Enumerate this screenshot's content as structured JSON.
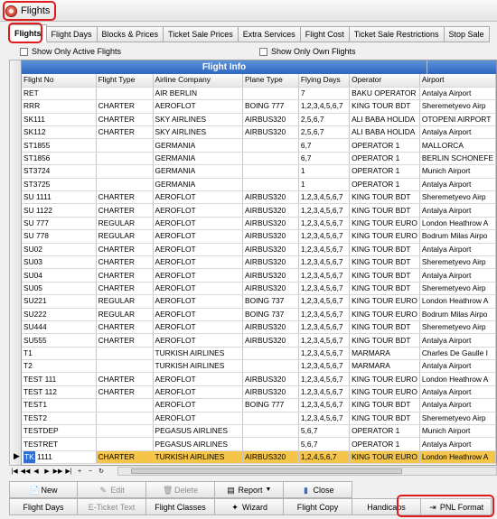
{
  "window": {
    "title": "Flights"
  },
  "tabs": [
    "Flights",
    "Flight Days",
    "Blocks & Prices",
    "Ticket Sale Prices",
    "Extra Services",
    "Flight Cost",
    "Ticket Sale Restrictions",
    "Stop Sale"
  ],
  "filters": {
    "active_label": "Show Only Active Flights",
    "own_label": "Show Only Own Flights"
  },
  "grid": {
    "group_title": "Flight Info",
    "columns": [
      "Flight No",
      "Flight Type",
      "Airline Company",
      "Plane Type",
      "Flying Days",
      "Operator",
      "Airport"
    ],
    "rows": [
      [
        "RET",
        "",
        "AIR BERLIN",
        "",
        "7",
        "BAKU OPERATOR",
        "Antalya Airport"
      ],
      [
        "RRR",
        "CHARTER",
        "AEROFLOT",
        "BOING 777",
        "1,2,3,4,5,6,7",
        "KING TOUR BDT",
        "Sheremetyevo Airp"
      ],
      [
        "SK111",
        "CHARTER",
        "SKY AIRLINES",
        "AIRBUS320",
        "2,5,6,7",
        "ALI BABA HOLIDA",
        "OTOPENI AIRPORT"
      ],
      [
        "SK112",
        "CHARTER",
        "SKY AIRLINES",
        "AIRBUS320",
        "2,5,6,7",
        "ALI BABA HOLIDA",
        "Antalya Airport"
      ],
      [
        "ST1855",
        "",
        "GERMANIA",
        "",
        "6,7",
        "OPERATOR 1",
        "MALLORCA"
      ],
      [
        "ST1856",
        "",
        "GERMANIA",
        "",
        "6,7",
        "OPERATOR 1",
        "BERLIN SCHONEFE"
      ],
      [
        "ST3724",
        "",
        "GERMANIA",
        "",
        "1",
        "OPERATOR 1",
        "Munich Airport"
      ],
      [
        "ST3725",
        "",
        "GERMANIA",
        "",
        "1",
        "OPERATOR 1",
        "Antalya Airport"
      ],
      [
        "SU 1111",
        "CHARTER",
        "AEROFLOT",
        "AIRBUS320",
        "1,2,3,4,5,6,7",
        "KING TOUR BDT",
        "Sheremetyevo Airp"
      ],
      [
        "SU 1122",
        "CHARTER",
        "AEROFLOT",
        "AIRBUS320",
        "1,2,3,4,5,6,7",
        "KING TOUR BDT",
        "Antalya Airport"
      ],
      [
        "SU 777",
        "REGULAR",
        "AEROFLOT",
        "AIRBUS320",
        "1,2,3,4,5,6,7",
        "KING TOUR EURO",
        "London Heathrow A"
      ],
      [
        "SU 778",
        "REGULAR",
        "AEROFLOT",
        "AIRBUS320",
        "1,2,3,4,5,6,7",
        "KING TOUR EURO",
        "Bodrum Milas Airpo"
      ],
      [
        "SU02",
        "CHARTER",
        "AEROFLOT",
        "AIRBUS320",
        "1,2,3,4,5,6,7",
        "KING TOUR BDT",
        "Antalya Airport"
      ],
      [
        "SU03",
        "CHARTER",
        "AEROFLOT",
        "AIRBUS320",
        "1,2,3,4,5,6,7",
        "KING TOUR BDT",
        "Sheremetyevo Airp"
      ],
      [
        "SU04",
        "CHARTER",
        "AEROFLOT",
        "AIRBUS320",
        "1,2,3,4,5,6,7",
        "KING TOUR BDT",
        "Antalya Airport"
      ],
      [
        "SU05",
        "CHARTER",
        "AEROFLOT",
        "AIRBUS320",
        "1,2,3,4,5,6,7",
        "KING TOUR BDT",
        "Sheremetyevo Airp"
      ],
      [
        "SU221",
        "REGULAR",
        "AEROFLOT",
        "BOING 737",
        "1,2,3,4,5,6,7",
        "KING TOUR EURO",
        "London Heathrow A"
      ],
      [
        "SU222",
        "REGULAR",
        "AEROFLOT",
        "BOING 737",
        "1,2,3,4,5,6,7",
        "KING TOUR EURO",
        "Bodrum Milas Airpo"
      ],
      [
        "SU444",
        "CHARTER",
        "AEROFLOT",
        "AIRBUS320",
        "1,2,3,4,5,6,7",
        "KING TOUR BDT",
        "Sheremetyevo Airp"
      ],
      [
        "SU555",
        "CHARTER",
        "AEROFLOT",
        "AIRBUS320",
        "1,2,3,4,5,6,7",
        "KING TOUR BDT",
        "Antalya Airport"
      ],
      [
        "T1",
        "",
        "TURKISH AIRLINES",
        "",
        "1,2,3,4,5,6,7",
        "MARMARA",
        "Charles De Gaulle I"
      ],
      [
        "T2",
        "",
        "TURKISH AIRLINES",
        "",
        "1,2,3,4,5,6,7",
        "MARMARA",
        "Antalya Airport"
      ],
      [
        "TEST 111",
        "CHARTER",
        "AEROFLOT",
        "AIRBUS320",
        "1,2,3,4,5,6,7",
        "KING TOUR EURO",
        "London Heathrow A"
      ],
      [
        "TEST 112",
        "CHARTER",
        "AEROFLOT",
        "AIRBUS320",
        "1,2,3,4,5,6,7",
        "KING TOUR EURO",
        "Antalya Airport"
      ],
      [
        "TEST1",
        "",
        "AEROFLOT",
        "BOING 777",
        "1,2,3,4,5,6,7",
        "KING TOUR BDT",
        "Antalya Airport"
      ],
      [
        "TEST2",
        "",
        "AEROFLOT",
        "",
        "1,2,3,4,5,6,7",
        "KING TOUR BDT",
        "Sheremetyevo Airp"
      ],
      [
        "TESTDEP",
        "",
        "PEGASUS AIRLINES",
        "",
        "5,6,7",
        "OPERATOR 1",
        "Munich Airport"
      ],
      [
        "TESTRET",
        "",
        "PEGASUS AIRLINES",
        "",
        "5,6,7",
        "OPERATOR 1",
        "Antalya Airport"
      ],
      [
        "TK 1111",
        "CHARTER",
        "TURKISH AIRLINES",
        "AIRBUS320",
        "1,2,4,5,6,7",
        "KING TOUR EURO",
        "London Heathrow A"
      ]
    ],
    "selected_row": 28,
    "selected_prefix": "TK",
    "selected_suffix": " 1111"
  },
  "buttons_row1": [
    {
      "label": "New",
      "icon": "new-icon",
      "disabled": false
    },
    {
      "label": "Edit",
      "icon": "edit-icon",
      "disabled": true
    },
    {
      "label": "Delete",
      "icon": "delete-icon",
      "disabled": true
    },
    {
      "label": "Report",
      "icon": "report-icon",
      "disabled": false
    },
    {
      "label": "Close",
      "icon": "close-icon",
      "disabled": false
    }
  ],
  "buttons_row2": [
    {
      "label": "Flight Days",
      "disabled": false
    },
    {
      "label": "E-Ticket Text",
      "disabled": true
    },
    {
      "label": "Flight Classes",
      "disabled": false
    },
    {
      "label": "Wizard",
      "disabled": false
    },
    {
      "label": "Flight Copy",
      "disabled": false
    },
    {
      "label": "Handicaps",
      "disabled": false
    },
    {
      "label": "PNL Format",
      "disabled": false
    }
  ],
  "colors": {
    "accent": "#2d67c0",
    "selection": "#f5c54a",
    "highlight": "#e01b1b"
  }
}
